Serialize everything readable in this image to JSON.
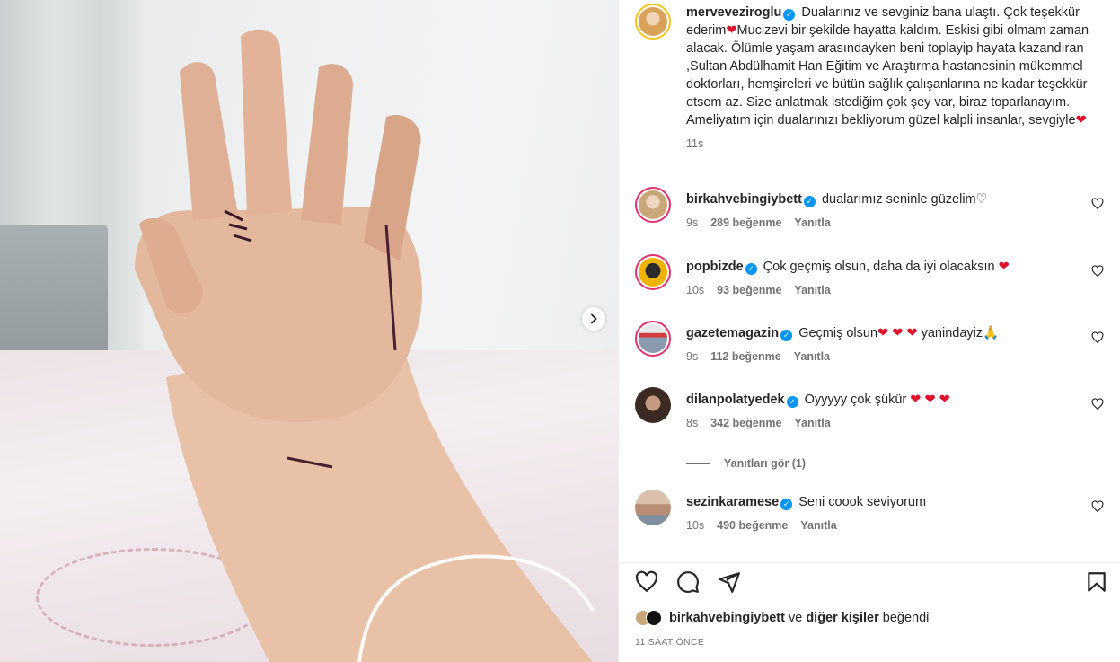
{
  "post": {
    "author": "merveveziroglu",
    "caption_parts": [
      "Dualarınız ve sevginiz bana ulaştı. Çok teşekkür ederim",
      "Mucizevi bir şekilde hayatta kaldım. Eskisi gibi olmam zaman alacak. Ölümle yaşam arasındayken beni toplayip hayata kazandıran ,Sultan Abdülhamit Han Eğitim ve Araştırma hastanesinin mükemmel doktorları, hemşireleri ve bütün sağlık çalışanlarına ne kadar teşekkür etsem az. Size anlatmak istediğim çok şey var, biraz toparlanayım. Ameliyatım için dualarınızı bekliyorum güzel kalpli insanlar, sevgiyle"
    ],
    "caption_time": "11s",
    "heart_glyph": "❤"
  },
  "comments": [
    {
      "user": "birkahvebingiybett",
      "text": "dualarımız seninle güzelim♡",
      "time": "9s",
      "likes": "289 beğenme",
      "reply": "Yanıtla",
      "avatar_color": "#c9a77a"
    },
    {
      "user": "popbizde",
      "text": "Çok geçmiş olsun, daha da iyi olacaksın ❤",
      "time": "10s",
      "likes": "93 beğenme",
      "reply": "Yanıtla",
      "avatar_color": "#111111"
    },
    {
      "user": "gazetemagazin",
      "text": "Geçmiş olsun❤ ❤ ❤ yanindayiz🙏",
      "time": "9s",
      "likes": "112 beğenme",
      "reply": "Yanıtla",
      "avatar_color": "#8a9bb0"
    },
    {
      "user": "dilanpolatyedek",
      "text": "Oyyyyy çok şükür ❤ ❤ ❤",
      "time": "8s",
      "likes": "342 beğenme",
      "reply": "Yanıtla",
      "avatar_color": "#3a2a22"
    },
    {
      "user": "sezinkaramese",
      "text": "Seni coook seviyorum",
      "time": "10s",
      "likes": "490 beğenme",
      "reply": "Yanıtla",
      "avatar_color": "#b98d73"
    }
  ],
  "replies_toggle": "Yanıtları gör (1)",
  "likes_summary": {
    "first_user": "birkahvebingiybett",
    "middle": "ve",
    "others": "diğer kişiler",
    "suffix": "beğendi"
  },
  "time_ago": "11 SAAT ÖNCE",
  "colors": {
    "accent_blue": "#0095f6",
    "heart_red": "#e0112b",
    "muted": "#737373",
    "story_ring": "#e1306c"
  },
  "icons": [
    "chevron-right-icon",
    "heart-icon",
    "comment-icon",
    "share-icon",
    "bookmark-icon",
    "verified-badge-icon"
  ]
}
